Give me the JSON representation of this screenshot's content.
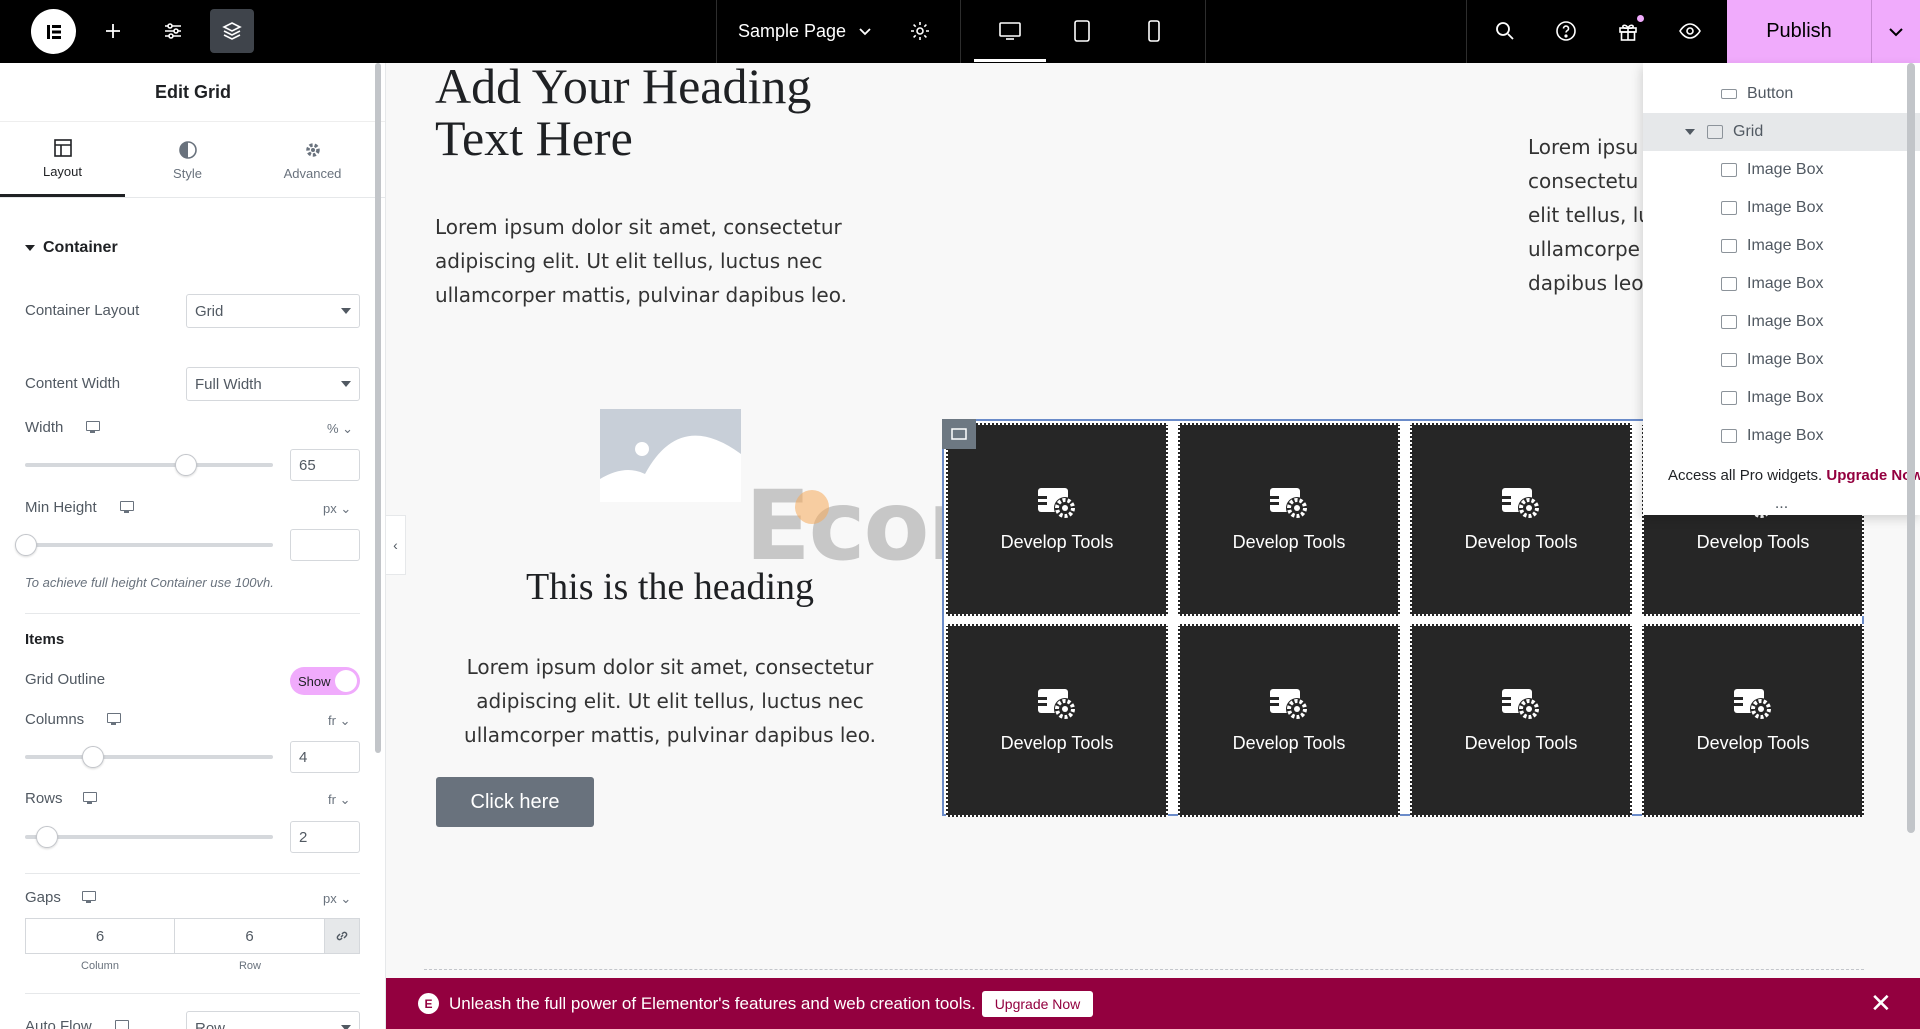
{
  "topbar": {
    "page_title": "Sample Page",
    "publish_label": "Publish",
    "accent": "#f0abfc"
  },
  "panel": {
    "title": "Edit Grid",
    "tabs": [
      {
        "label": "Layout",
        "icon": "layout-icon",
        "active": true
      },
      {
        "label": "Style",
        "icon": "style-icon",
        "active": false
      },
      {
        "label": "Advanced",
        "icon": "gear-icon",
        "active": false
      }
    ],
    "section_container": "Container",
    "container_layout": {
      "label": "Container Layout",
      "value": "Grid"
    },
    "content_width": {
      "label": "Content Width",
      "value": "Full Width"
    },
    "width": {
      "label": "Width",
      "unit": "%",
      "value": "65"
    },
    "min_height": {
      "label": "Min Height",
      "unit": "px",
      "value": ""
    },
    "min_height_hint": "To achieve full height Container use 100vh.",
    "items_heading": "Items",
    "grid_outline": {
      "label": "Grid Outline",
      "value": "Show"
    },
    "columns": {
      "label": "Columns",
      "unit": "fr",
      "value": "4"
    },
    "rows": {
      "label": "Rows",
      "unit": "fr",
      "value": "2"
    },
    "gaps": {
      "label": "Gaps",
      "unit": "px",
      "column_value": "6",
      "row_value": "6",
      "column_caption": "Column",
      "row_caption": "Row"
    },
    "auto_flow": {
      "label": "Auto Flow",
      "value": "Row"
    }
  },
  "canvas": {
    "heading_1": "Add Your Heading Text Here",
    "paragraph_1": "Lorem ipsum dolor sit amet, consectetur adipiscing elit. Ut elit tellus, luctus nec ullamcorper mattis, pulvinar dapibus leo.",
    "paragraph_right_lines": [
      "Lorem ipsu",
      "consectetu",
      "elit tellus, lu",
      "ullamcorpe",
      "dapibus leo"
    ],
    "heading_2": "This is the heading",
    "paragraph_2": "Lorem ipsum dolor sit amet, consectetur adipiscing elit. Ut elit tellus, luctus nec ullamcorper mattis, pulvinar dapibus leo.",
    "button_label": "Click here",
    "grid_cells": [
      "Develop Tools",
      "Develop Tools",
      "Develop Tools",
      "Develop Tools",
      "Develop Tools",
      "Develop Tools",
      "Develop Tools",
      "Develop Tools"
    ],
    "watermark": "Ecomools"
  },
  "navigator": {
    "items": [
      {
        "label": "Button",
        "icon": "button-icon",
        "selected": false,
        "indent": 1
      },
      {
        "label": "Grid",
        "icon": "grid-icon",
        "selected": true,
        "indent": 0
      },
      {
        "label": "Image Box",
        "icon": "image-box-icon",
        "selected": false,
        "indent": 1
      },
      {
        "label": "Image Box",
        "icon": "image-box-icon",
        "selected": false,
        "indent": 1
      },
      {
        "label": "Image Box",
        "icon": "image-box-icon",
        "selected": false,
        "indent": 1
      },
      {
        "label": "Image Box",
        "icon": "image-box-icon",
        "selected": false,
        "indent": 1
      },
      {
        "label": "Image Box",
        "icon": "image-box-icon",
        "selected": false,
        "indent": 1
      },
      {
        "label": "Image Box",
        "icon": "image-box-icon",
        "selected": false,
        "indent": 1
      },
      {
        "label": "Image Box",
        "icon": "image-box-icon",
        "selected": false,
        "indent": 1
      },
      {
        "label": "Image Box",
        "icon": "image-box-icon",
        "selected": false,
        "indent": 1
      }
    ],
    "footer_text": "Access all Pro widgets.",
    "footer_link": "Upgrade Now",
    "more": "..."
  },
  "promo": {
    "text": "Unleash the full power of Elementor's features and web creation tools.",
    "button": "Upgrade Now",
    "color": "#93003f"
  }
}
